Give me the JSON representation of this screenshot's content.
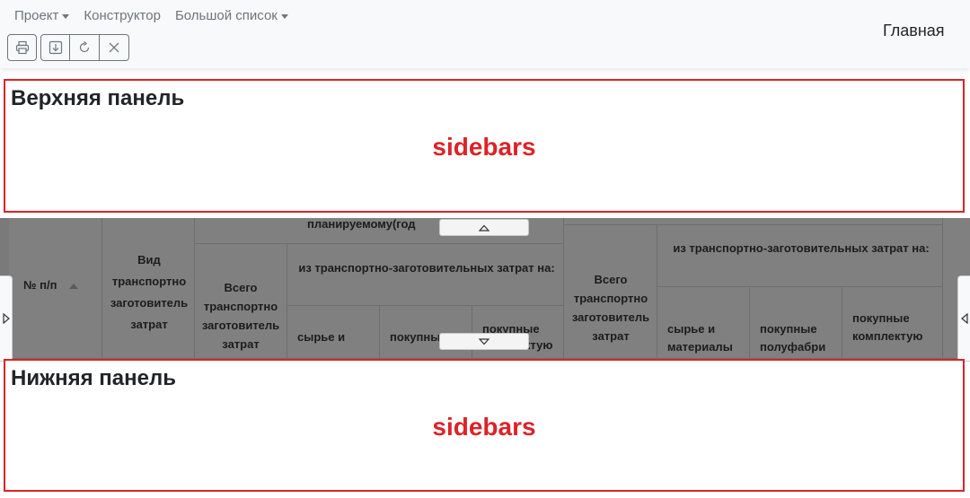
{
  "header": {
    "menu": [
      {
        "label": "Проект",
        "dropdown": true
      },
      {
        "label": "Конструктор",
        "dropdown": false
      },
      {
        "label": "Большой список",
        "dropdown": true
      }
    ],
    "home_label": "Главная",
    "toolbar_icons": [
      "print-icon",
      "download-icon",
      "refresh-icon",
      "close-icon"
    ]
  },
  "top_panel": {
    "title": "Верхняя панель",
    "center_label": "sidebars"
  },
  "bottom_panel": {
    "title": "Нижняя панель",
    "center_label": "sidebars"
  },
  "grid": {
    "col_num": "№ п/п",
    "col_type": "Вид транспортно заготовитель затрат",
    "group_plan": "планируемому(год",
    "col_total_1": "Всего транспортно заготовитель затрат",
    "group_transport_1": "из транспортно-заготовительных затрат на:",
    "col_raw_1": "сырье и",
    "col_purchased_1": "покупные",
    "col_components_1": "покупные комплектую",
    "col_total_2": "Всего транспортно заготовитель затрат",
    "group_transport_2": "из транспортно-заготовительных затрат на:",
    "col_raw_2": "сырье и материалы",
    "col_semi_2": "покупные полуфабри",
    "col_components_2": "покупные комплектую"
  },
  "colors": {
    "accent_red": "#dc2328",
    "navbar_bg": "#f8f9fa",
    "grid_overlay": "#7a7a7a"
  }
}
